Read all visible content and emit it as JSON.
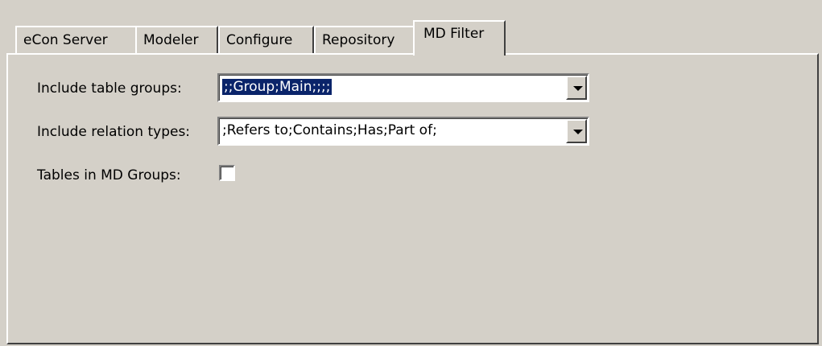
{
  "tabs": [
    {
      "label": "eCon Server",
      "active": false
    },
    {
      "label": "Modeler",
      "active": false
    },
    {
      "label": "Configure",
      "active": false
    },
    {
      "label": "Repository",
      "active": false
    },
    {
      "label": "MD Filter",
      "active": true
    }
  ],
  "form": {
    "table_groups_label": "Include table groups:",
    "table_groups_value": ";;Group;Main;;;;",
    "relation_types_label": "Include relation types:",
    "relation_types_value": ";Refers to;Contains;Has;Part of;",
    "md_groups_label": "Tables in MD Groups:",
    "md_groups_checked": false
  },
  "icons": {
    "dropdown": "chevron-down-icon"
  }
}
